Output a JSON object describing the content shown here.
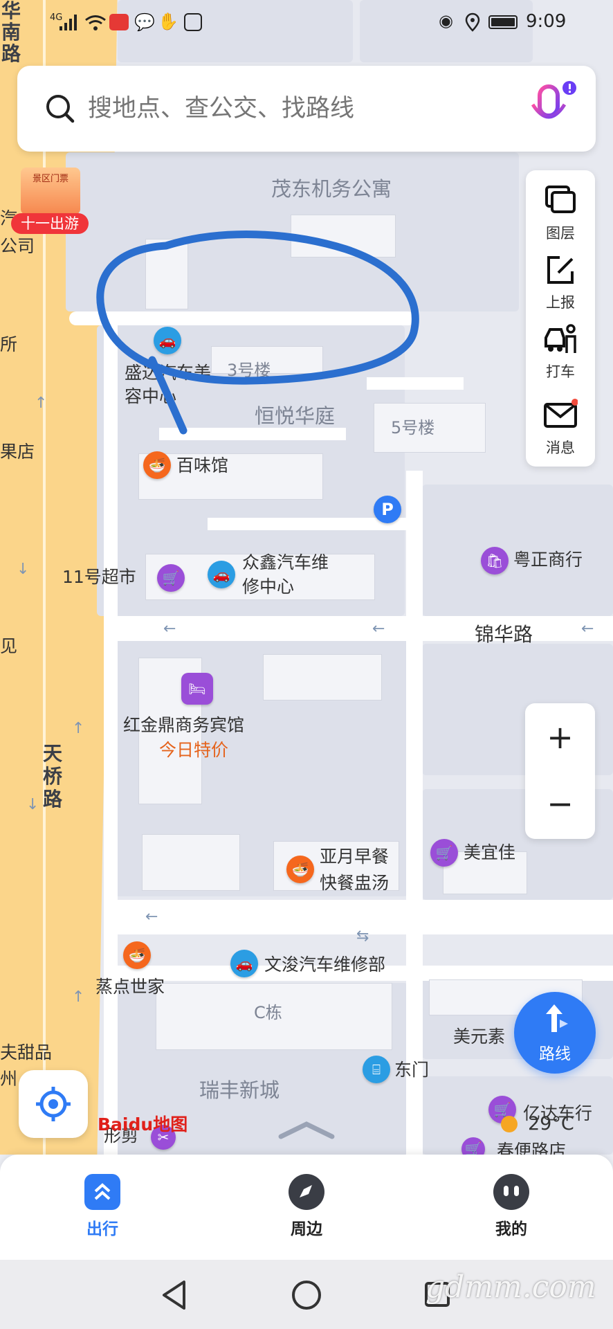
{
  "status_bar": {
    "network": "4G",
    "time": "9:09"
  },
  "search": {
    "placeholder": "搜地点、查公交、找路线"
  },
  "promo": {
    "badge_top": "景区门票",
    "label": "十一出游"
  },
  "tools": [
    {
      "icon": "layers-icon",
      "label": "图层"
    },
    {
      "icon": "report-icon",
      "label": "上报"
    },
    {
      "icon": "taxi-icon",
      "label": "打车"
    },
    {
      "icon": "message-icon",
      "label": "消息"
    }
  ],
  "map": {
    "areas": {
      "maodong": "茂东机务公寓",
      "hengyue": "恒悦华庭",
      "ruifeng": "瑞丰新城",
      "building3": "3号楼",
      "building5": "5号楼",
      "buildingC": "C栋"
    },
    "roads": {
      "tianqiao": "天桥路",
      "jinhua": "锦华路",
      "huanan": "华南路"
    },
    "pois": {
      "shengda": "盛达汽车美容中心",
      "baiwei": "百味馆",
      "supermarket11": "11号超市",
      "zhongxin": "众鑫汽车维修中心",
      "yuezheng": "粤正商行",
      "hongjinding": "红金鼎商务宾馆",
      "deal": "今日特价",
      "yayue_line1": "亚月早餐",
      "yayue_line2": "快餐盅汤",
      "meiyijia": "美宜佳",
      "zhengdian": "蒸点世家",
      "wenjun": "文浚汽车维修部",
      "dongmen": "东门",
      "meiyuan": "美元素",
      "yida": "亿达车行",
      "chunbian": "春便路店",
      "xingjian": "形剪"
    },
    "edge_labels": {
      "qi": "汽",
      "gongsi": "公司",
      "suo": "所",
      "guodian": "果店",
      "jian": "见",
      "tianpin": "夫甜品",
      "zhou": "州"
    },
    "weather": "29°C",
    "logo": "Baidu地图"
  },
  "zoom": {
    "in": "+",
    "out": "−"
  },
  "route_button": {
    "label": "路线"
  },
  "bottom_nav": [
    {
      "icon": "travel-icon",
      "label": "出行",
      "active": true
    },
    {
      "icon": "compass-icon",
      "label": "周边",
      "active": false
    },
    {
      "icon": "profile-icon",
      "label": "我的",
      "active": false
    }
  ],
  "watermark": "gdmm.com",
  "colors": {
    "accent": "#2f7bf5",
    "poi_orange": "#f5671d",
    "poi_blue": "#2b9de3",
    "poi_purple": "#9a4ed8",
    "highway": "#fbd58a",
    "annotation": "#2b6fcf"
  }
}
